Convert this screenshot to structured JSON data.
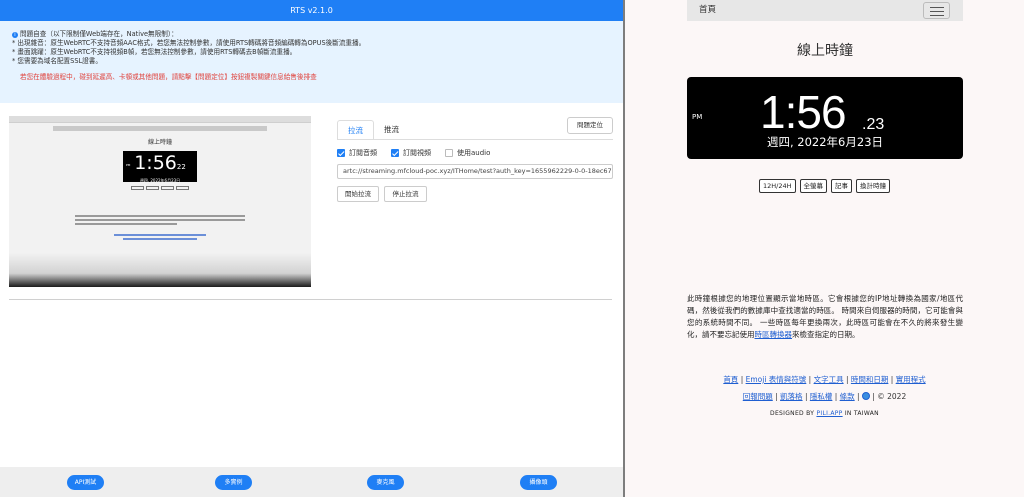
{
  "left": {
    "title": "RTS v2.1.0",
    "notice": {
      "lines": [
        "問題自查（以下限制僅Web端存在，Native無限制）：",
        "* 出現雜音：原生WebRTC不支持音頻AAC格式，若您無法控制參數，請使用RTS轉碼將音頻編碼轉為OPUS後斷流重播。",
        "* 畫面跳躍：原生WebRTC不支持視頻B幀，若您無法控制參數，請使用RTS轉碼去B幀斷流重播。",
        "* 您需要為域名配置SSL證書。"
      ],
      "warning": "若您在體驗過程中，碰到延遲高、卡頓或其他問題，請點擊【問題定位】按鈕複製關鍵信息給售後排查"
    },
    "preview": {
      "title": "線上時鐘",
      "time": "1:56",
      "seconds": "22",
      "date": "週四, 2022年6月23日",
      "ampm": "PM"
    },
    "tabs": [
      "拉流",
      "推流"
    ],
    "locate_label": "問題定位",
    "checkboxes": [
      {
        "label": "訂閱音頻",
        "checked": true
      },
      {
        "label": "訂閱視頻",
        "checked": true
      },
      {
        "label": "使用audio",
        "checked": false
      }
    ],
    "url_value": "artc://streaming.mfcloud-poc.xyz/ITHome/test?auth_key=1655962229-0-0-18ec67c9",
    "start_label": "開始拉流",
    "stop_label": "停止拉流",
    "bottom_buttons": [
      "API測試",
      "多實例",
      "麥克風",
      "攝像頭"
    ]
  },
  "right": {
    "nav_home": "首頁",
    "title": "線上時鐘",
    "clock": {
      "ampm": "PM",
      "time": "1:56",
      "seconds": ".23",
      "date": "週四, 2022年6月23日"
    },
    "buttons": [
      "12H/24H",
      "全螢幕",
      "記事",
      "換計時鐘"
    ],
    "description_pre": "此時鐘根據您的地理位置顯示當地時區。它會根據您的IP地址轉換為國家/地區代碼，然後從我們的數據庫中查找適當的時區。 時間來自伺服器的時間，它可能會與您的系統時間不同。 一些時區每年更換兩次，此時區可能會在不久的將來發生變化，請不要忘記使用",
    "description_link": "時區轉換器",
    "description_post": "來檢查指定的日期。",
    "footer_links": [
      "首頁",
      "Emoji 表情與符號",
      "文字工具",
      "時間和日期",
      "實用程式"
    ],
    "footer_links2": [
      "回報問題",
      "凱落格",
      "隱私權",
      "條款"
    ],
    "copyright": "| © 2022",
    "designed_by": "DESIGNED BY",
    "designed_brand": "PILI.APP",
    "designed_in": "IN TAIWAN",
    "colors": {
      "accent": "#1f7ff5",
      "clock_bg": "#000000",
      "page_bg": "#fcf7f7"
    }
  }
}
